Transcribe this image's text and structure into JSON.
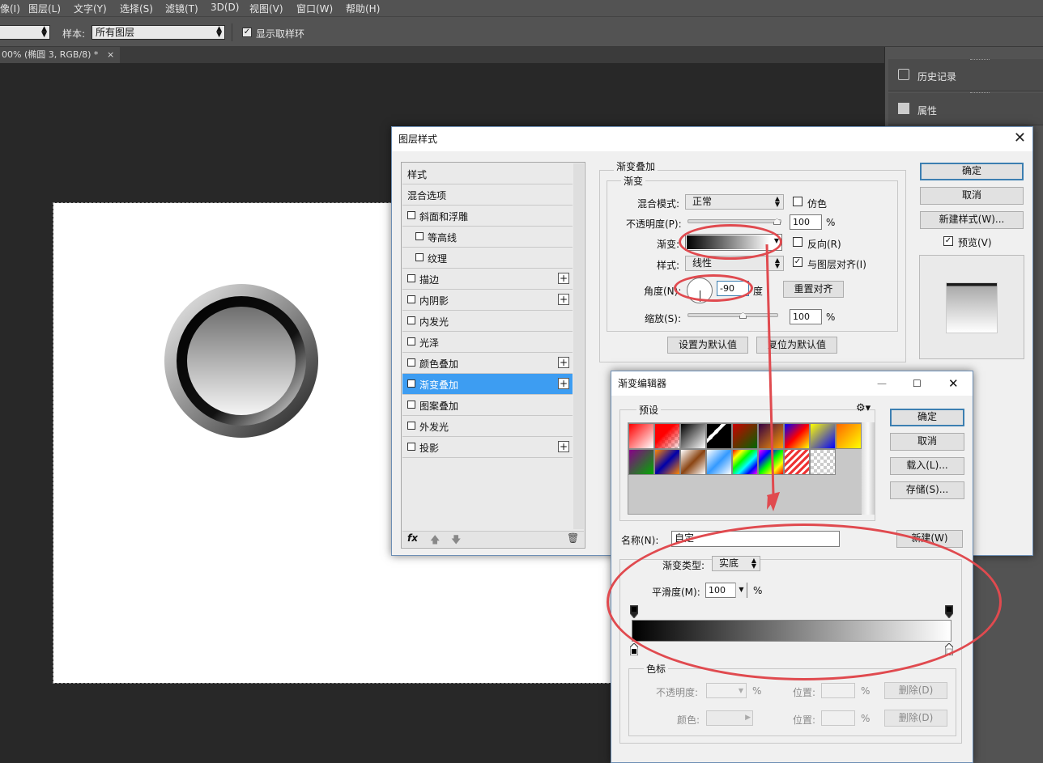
{
  "menubar": {
    "items": [
      "像(I)",
      "图层(L)",
      "文字(Y)",
      "选择(S)",
      "滤镜(T)",
      "3D(D)",
      "视图(V)",
      "窗口(W)",
      "帮助(H)"
    ]
  },
  "options": {
    "sample_label": "样本:",
    "sample_value": "所有图层",
    "show_ring_label": "显示取样环",
    "show_ring_checked": true
  },
  "doc_tab": {
    "title": "00% (椭圆 3, RGB/8) *",
    "close": "×"
  },
  "right_panel": {
    "history": "历史记录",
    "properties": "属性"
  },
  "layer_style": {
    "title": "图层样式",
    "list": [
      {
        "label": "样式",
        "checkbox": false,
        "plus": false,
        "indent": 0,
        "selected": false,
        "header": true
      },
      {
        "label": "混合选项",
        "checkbox": false,
        "plus": false,
        "indent": 0,
        "selected": false,
        "header": true
      },
      {
        "label": "斜面和浮雕",
        "checkbox": true,
        "checked": false,
        "plus": false,
        "indent": 0,
        "selected": false
      },
      {
        "label": "等高线",
        "checkbox": true,
        "checked": false,
        "plus": false,
        "indent": 1,
        "selected": false
      },
      {
        "label": "纹理",
        "checkbox": true,
        "checked": false,
        "plus": false,
        "indent": 1,
        "selected": false
      },
      {
        "label": "描边",
        "checkbox": true,
        "checked": false,
        "plus": true,
        "indent": 0,
        "selected": false
      },
      {
        "label": "内阴影",
        "checkbox": true,
        "checked": false,
        "plus": true,
        "indent": 0,
        "selected": false
      },
      {
        "label": "内发光",
        "checkbox": true,
        "checked": false,
        "plus": false,
        "indent": 0,
        "selected": false
      },
      {
        "label": "光泽",
        "checkbox": true,
        "checked": false,
        "plus": false,
        "indent": 0,
        "selected": false
      },
      {
        "label": "颜色叠加",
        "checkbox": true,
        "checked": false,
        "plus": true,
        "indent": 0,
        "selected": false
      },
      {
        "label": "渐变叠加",
        "checkbox": true,
        "checked": true,
        "plus": true,
        "indent": 0,
        "selected": true
      },
      {
        "label": "图案叠加",
        "checkbox": true,
        "checked": false,
        "plus": false,
        "indent": 0,
        "selected": false
      },
      {
        "label": "外发光",
        "checkbox": true,
        "checked": false,
        "plus": false,
        "indent": 0,
        "selected": false
      },
      {
        "label": "投影",
        "checkbox": true,
        "checked": false,
        "plus": true,
        "indent": 0,
        "selected": false
      }
    ],
    "fx": "fx",
    "section_title": "渐变叠加",
    "group_title": "渐变",
    "blend_mode_label": "混合模式:",
    "blend_mode_value": "正常",
    "dither_label": "仿色",
    "opacity_label": "不透明度(P):",
    "opacity_value": "100",
    "opacity_percent": 1.0,
    "percent": "%",
    "gradient_label": "渐变:",
    "reverse_label": "反向(R)",
    "style_label": "样式:",
    "style_value": "线性",
    "align_label": "与图层对齐(I)",
    "align_checked": true,
    "angle_label": "角度(N):",
    "angle_value": "-90",
    "angle_unit": "度",
    "reset_align": "重置对齐",
    "scale_label": "缩放(S):",
    "scale_value": "100",
    "scale_percent": 0.5,
    "make_default": "设置为默认值",
    "reset_default": "复位为默认值",
    "ok": "确定",
    "cancel": "取消",
    "new_style": "新建样式(W)...",
    "preview_label": "预览(V)",
    "preview_checked": true
  },
  "gradient_editor": {
    "title": "渐变编辑器",
    "presets_label": "预设",
    "ok": "确定",
    "cancel": "取消",
    "load": "载入(L)...",
    "save": "存储(S)...",
    "name_label": "名称(N):",
    "name_value": "自定",
    "new": "新建(W)",
    "type_label": "渐变类型:",
    "type_value": "实底",
    "smooth_label": "平滑度(M):",
    "smooth_value": "100",
    "percent": "%",
    "stops_title": "色标",
    "stop_opacity_label": "不透明度:",
    "stop_position_label": "位置:",
    "stop_color_label": "颜色:",
    "delete": "删除(D)",
    "window_min": "—",
    "window_max": "☐",
    "window_close": "✕"
  },
  "colors": {
    "accent_selected": "#3d9df2",
    "annotation_red": "#e04a4f"
  }
}
